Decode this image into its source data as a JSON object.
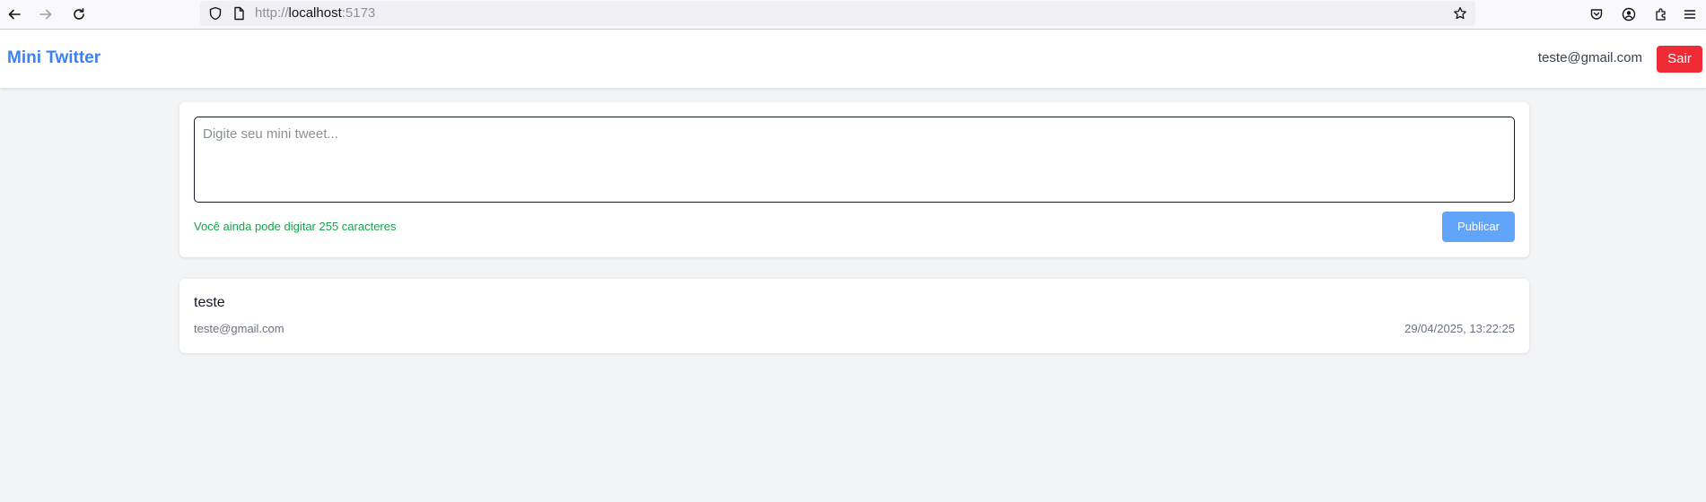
{
  "browser": {
    "url_scheme": "http://",
    "url_host": "localhost",
    "url_port": ":5173"
  },
  "header": {
    "brand": "Mini Twitter",
    "user_email": "teste@gmail.com",
    "logout_label": "Sair"
  },
  "compose": {
    "placeholder": "Digite seu mini tweet...",
    "value": "",
    "char_counter": "Você ainda pode digitar 255 caracteres",
    "publish_label": "Publicar"
  },
  "tweets": [
    {
      "content": "teste",
      "author": "teste@gmail.com",
      "timestamp": "29/04/2025, 13:22:25"
    }
  ],
  "colors": {
    "brand": "#3b82f6",
    "logout": "#ef2b36",
    "publish": "#60a5fa",
    "counter_ok": "#16a34a",
    "background": "#f3f4f6"
  },
  "icons": {
    "back": "arrow-left-icon",
    "forward": "arrow-right-icon",
    "reload": "reload-icon",
    "tracking": "shield-icon",
    "page": "page-icon",
    "bookmark": "star-icon",
    "pocket": "pocket-icon",
    "account": "account-icon",
    "extensions": "puzzle-icon",
    "menu": "hamburger-menu-icon"
  }
}
